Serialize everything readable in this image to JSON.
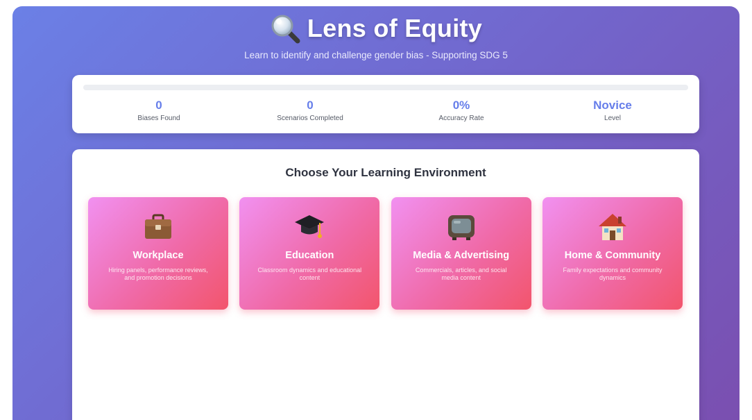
{
  "app": {
    "title": "Lens of Equity",
    "subtitle": "Learn to identify and challenge gender bias - Supporting SDG 5",
    "icon": "magnifying-glass-icon"
  },
  "progress": {
    "percent": 0
  },
  "stats": [
    {
      "value": "0",
      "label": "Biases Found"
    },
    {
      "value": "0",
      "label": "Scenarios Completed"
    },
    {
      "value": "0%",
      "label": "Accuracy Rate"
    },
    {
      "value": "Novice",
      "label": "Level"
    }
  ],
  "environments": {
    "heading": "Choose Your Learning Environment",
    "items": [
      {
        "icon": "briefcase-icon",
        "name": "Workplace",
        "description": "Hiring panels, performance reviews, and promotion decisions"
      },
      {
        "icon": "graduation-cap-icon",
        "name": "Education",
        "description": "Classroom dynamics and educational content"
      },
      {
        "icon": "television-icon",
        "name": "Media & Advertising",
        "description": "Commercials, articles, and social media content"
      },
      {
        "icon": "house-icon",
        "name": "Home & Community",
        "description": "Family expectations and community dynamics"
      }
    ]
  },
  "colors": {
    "accent": "#667eea",
    "card_gradient_start": "#f191f1",
    "card_gradient_end": "#f2556c",
    "background_start": "#6b80e6",
    "background_end": "#7a4fb0"
  }
}
